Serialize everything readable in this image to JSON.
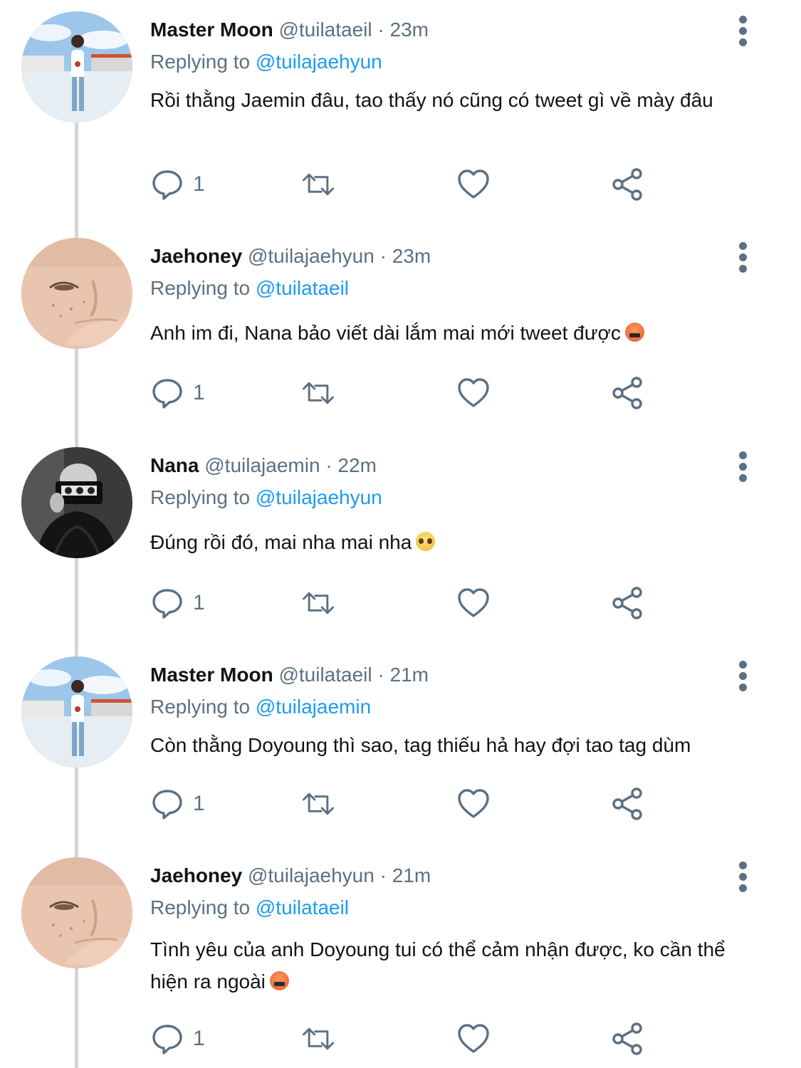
{
  "tweets": [
    {
      "name": "Master Moon",
      "handle": "@tuilataeil",
      "separator": "·",
      "time": "23m",
      "replying_prefix": "Replying to",
      "replying_to": "@tuilajaehyun",
      "text": "Rồi thằng Jaemin đâu, tao thấy nó cũng có tweet gì về mày đâu",
      "emoji": "",
      "reply_count": "1",
      "avatar": "avatar-master-moon"
    },
    {
      "name": "Jaehoney",
      "handle": "@tuilajaehyun",
      "separator": "·",
      "time": "23m",
      "replying_prefix": "Replying to",
      "replying_to": "@tuilataeil",
      "text": "Anh im đi, Nana bảo viết dài lắm mai mới tweet được",
      "emoji": "angry-face",
      "reply_count": "1",
      "avatar": "avatar-jaehoney"
    },
    {
      "name": "Nana",
      "handle": "@tuilajaemin",
      "separator": "·",
      "time": "22m",
      "replying_prefix": "Replying to",
      "replying_to": "@tuilajaehyun",
      "text": "Đúng rồi đó, mai nha mai nha",
      "emoji": "pleading-face",
      "reply_count": "1",
      "avatar": "avatar-nana"
    },
    {
      "name": "Master Moon",
      "handle": "@tuilataeil",
      "separator": "·",
      "time": "21m",
      "replying_prefix": "Replying to",
      "replying_to": "@tuilajaemin",
      "text": "Còn thằng Doyoung thì sao, tag thiếu hả hay đợi tao tag dùm",
      "emoji": "",
      "reply_count": "1",
      "avatar": "avatar-master-moon"
    },
    {
      "name": "Jaehoney",
      "handle": "@tuilajaehyun",
      "separator": "·",
      "time": "21m",
      "replying_prefix": "Replying to",
      "replying_to": "@tuilataeil",
      "text": "Tình yêu của anh Doyoung tui có thể cảm nhận được, ko cần thể hiện ra ngoài",
      "emoji": "angry-face",
      "reply_count": "1",
      "avatar": "avatar-jaehoney"
    }
  ],
  "colors": {
    "text": "#0f1419",
    "secondary": "#5b7083",
    "mention": "#1d9bf0",
    "thread_line": "#d3d6d9"
  },
  "icons": [
    "reply-icon",
    "retweet-icon",
    "like-icon",
    "share-icon",
    "more-icon"
  ]
}
